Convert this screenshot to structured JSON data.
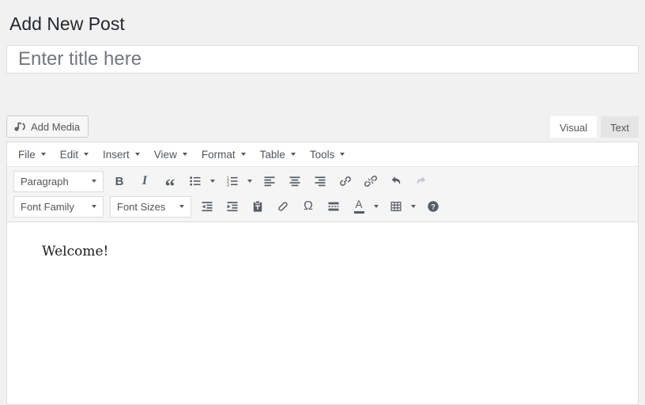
{
  "page": {
    "heading": "Add New Post"
  },
  "title_input": {
    "placeholder": "Enter title here",
    "value": ""
  },
  "media_bar": {
    "add_media_label": "Add Media"
  },
  "editor_tabs": {
    "visual": "Visual",
    "text": "Text",
    "active_tab": "Visual"
  },
  "menubar": {
    "items": [
      {
        "label": "File"
      },
      {
        "label": "Edit"
      },
      {
        "label": "Insert"
      },
      {
        "label": "View"
      },
      {
        "label": "Format"
      },
      {
        "label": "Table"
      },
      {
        "label": "Tools"
      }
    ]
  },
  "toolbar": {
    "row1": {
      "block_format": {
        "value": "Paragraph"
      },
      "buttons": [
        {
          "name": "bold",
          "glyph": "B"
        },
        {
          "name": "italic",
          "glyph": "I"
        },
        {
          "name": "blockquote",
          "glyph": "“"
        },
        {
          "name": "bulleted-list"
        },
        {
          "name": "numbered-list"
        },
        {
          "name": "align-left"
        },
        {
          "name": "align-center"
        },
        {
          "name": "align-right"
        },
        {
          "name": "insert-link"
        },
        {
          "name": "remove-link"
        },
        {
          "name": "undo"
        },
        {
          "name": "redo",
          "state": "disabled"
        }
      ]
    },
    "row2": {
      "font_family": {
        "value": "Font Family"
      },
      "font_sizes": {
        "value": "Font Sizes"
      },
      "buttons": [
        {
          "name": "outdent"
        },
        {
          "name": "indent"
        },
        {
          "name": "paste-as-text"
        },
        {
          "name": "clear-formatting"
        },
        {
          "name": "special-character",
          "glyph": "Ω"
        },
        {
          "name": "insert-read-more-tag"
        },
        {
          "name": "text-color",
          "glyph": "A"
        },
        {
          "name": "table"
        },
        {
          "name": "help"
        }
      ]
    }
  },
  "editor": {
    "content": "Welcome!"
  },
  "colors": {
    "page_bg": "#f1f1f1",
    "toolbar_bg": "#f5f5f5",
    "icon": "#555d66",
    "disabled_icon": "#c5c9cd",
    "border": "#dddddd",
    "heading_text": "#23282d",
    "placeholder_text": "#72777c",
    "tab_inactive_bg": "#e5e5e5"
  }
}
